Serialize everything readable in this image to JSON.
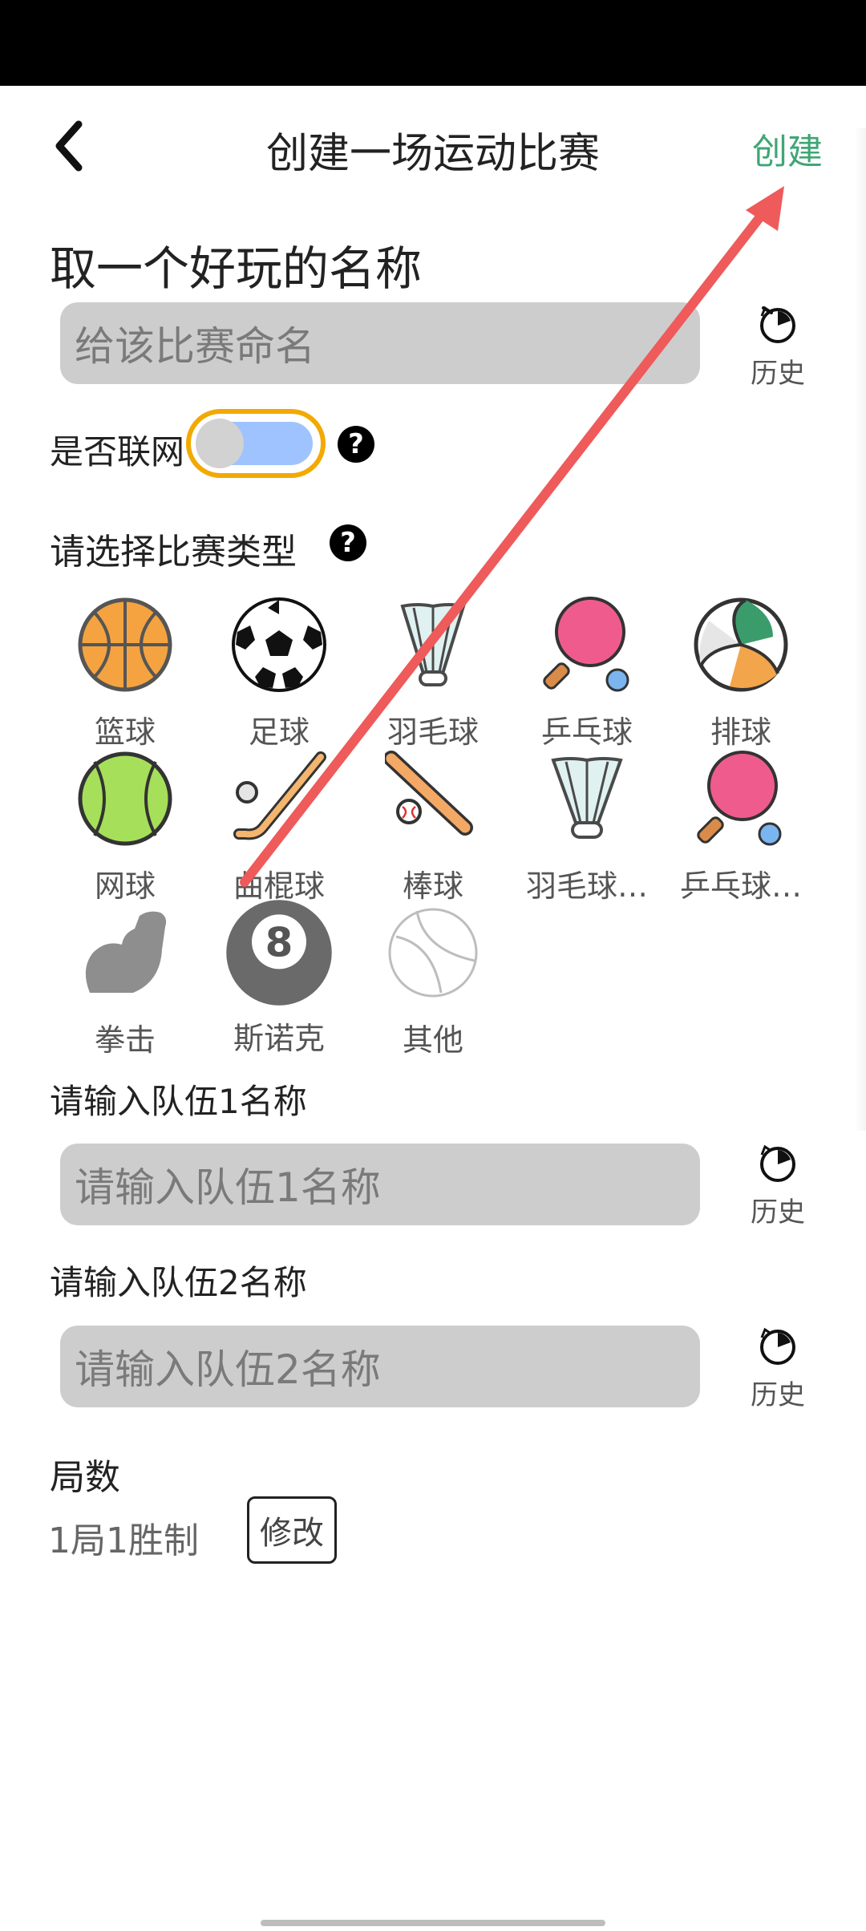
{
  "header": {
    "title": "创建一场运动比赛",
    "create_label": "创建"
  },
  "name_section": {
    "title": "取一个好玩的名称",
    "placeholder": "给该比赛命名",
    "history_label": "历史"
  },
  "network": {
    "label": "是否联网",
    "help": "?"
  },
  "type_section": {
    "title": "请选择比赛类型",
    "help": "?",
    "sports": [
      {
        "label": "篮球",
        "icon": "basketball-icon"
      },
      {
        "label": "足球",
        "icon": "soccer-ball-icon"
      },
      {
        "label": "羽毛球",
        "icon": "shuttlecock-icon"
      },
      {
        "label": "乒乓球",
        "icon": "ping-pong-paddle-icon"
      },
      {
        "label": "排球",
        "icon": "volleyball-icon"
      },
      {
        "label": "网球",
        "icon": "tennis-ball-icon"
      },
      {
        "label": "曲棍球",
        "icon": "hockey-stick-icon"
      },
      {
        "label": "棒球",
        "icon": "baseball-bat-icon"
      },
      {
        "label": "羽毛球…",
        "icon": "shuttlecock-icon"
      },
      {
        "label": "乒乓球…",
        "icon": "ping-pong-paddle-icon"
      },
      {
        "label": "拳击",
        "icon": "flexed-arm-icon"
      },
      {
        "label": "斯诺克",
        "icon": "eight-ball-icon"
      },
      {
        "label": "其他",
        "icon": "generic-ball-icon"
      }
    ]
  },
  "team1": {
    "label": "请输入队伍1名称",
    "placeholder": "请输入队伍1名称",
    "history_label": "历史"
  },
  "team2": {
    "label": "请输入队伍2名称",
    "placeholder": "请输入队伍2名称",
    "history_label": "历史"
  },
  "rounds": {
    "label": "局数",
    "value": "1局1胜制",
    "modify_label": "修改"
  },
  "colors": {
    "accent_green": "#3fa675",
    "toggle_border": "#f2a900",
    "toggle_track": "#9ec3ff",
    "annotation_arrow": "#ef5a5a"
  }
}
